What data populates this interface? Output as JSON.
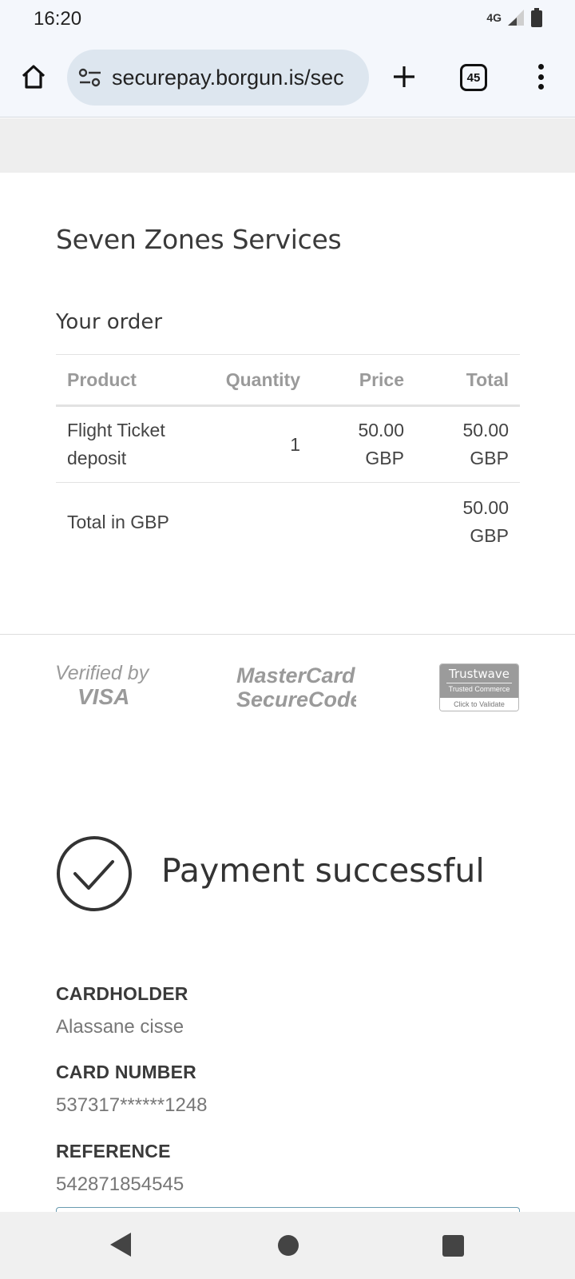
{
  "status": {
    "time": "16:20",
    "network": "4G"
  },
  "browser": {
    "url": "securepay.borgun.is/sec",
    "tab_count": "45"
  },
  "merchant": {
    "name": "Seven Zones Services"
  },
  "order": {
    "heading": "Your order",
    "columns": [
      "Product",
      "Quantity",
      "Price",
      "Total"
    ],
    "rows": [
      {
        "product": "Flight Ticket deposit",
        "quantity": "1",
        "price_amount": "50.00",
        "price_currency": "GBP",
        "total_amount": "50.00",
        "total_currency": "GBP"
      }
    ],
    "total_label": "Total in GBP",
    "total_amount": "50.00",
    "total_currency": "GBP"
  },
  "logos": {
    "visa_line1": "Verified by",
    "visa_line2": "VISA",
    "mc_line1": "MasterCard",
    "mc_line2": "SecureCode",
    "trustwave_brand": "Trustwave",
    "trustwave_sub": "Trusted Commerce",
    "trustwave_cta": "Click to Validate"
  },
  "result": {
    "message": "Payment successful",
    "cardholder_label": "CARDHOLDER",
    "cardholder_value": "Alassane cisse",
    "card_number_label": "CARD NUMBER",
    "card_number_value": "537317******1248",
    "reference_label": "REFERENCE",
    "reference_value": "542871854545"
  }
}
